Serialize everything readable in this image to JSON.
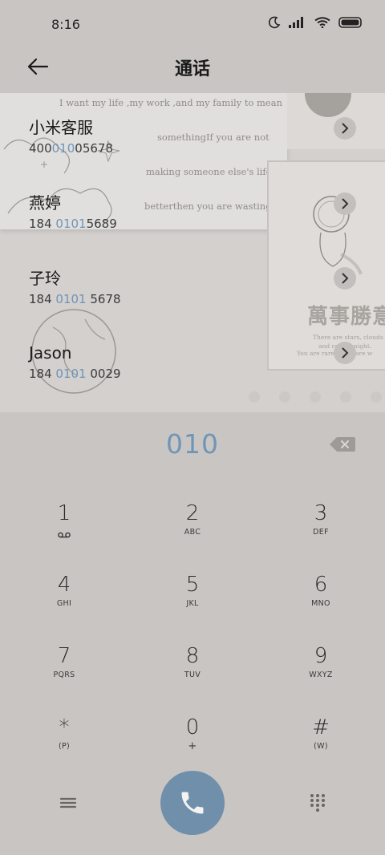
{
  "status": {
    "time": "8:16"
  },
  "header": {
    "title": "通话"
  },
  "wallpaper": {
    "quotes": [
      "I want my life ,my work ,and my family to mean",
      "somethingIf you are not",
      "making someone else's life",
      "betterthen you are wasting"
    ],
    "poster_big": "萬事勝意",
    "poster_small": [
      "There are stars, clouds",
      "and rain at night.",
      "You are rarer this rare w"
    ]
  },
  "contacts": [
    {
      "name": "小米客服",
      "num_pre": "400",
      "num_hl": "010",
      "num_post": "05678"
    },
    {
      "name": "燕婷",
      "num_pre": "184 ",
      "num_hl": "0101",
      "num_post": "5689"
    },
    {
      "name": "子玲",
      "num_pre": "184 ",
      "num_hl": "0101",
      "num_post": " 5678"
    },
    {
      "name": "Jason",
      "num_pre": "184 ",
      "num_hl": "0101",
      "num_post": " 0029"
    }
  ],
  "dialer": {
    "input": "010",
    "keys": [
      {
        "digit": "1",
        "letters": ""
      },
      {
        "digit": "2",
        "letters": "ABC"
      },
      {
        "digit": "3",
        "letters": "DEF"
      },
      {
        "digit": "4",
        "letters": "GHI"
      },
      {
        "digit": "5",
        "letters": "JKL"
      },
      {
        "digit": "6",
        "letters": "MNO"
      },
      {
        "digit": "7",
        "letters": "PQRS"
      },
      {
        "digit": "8",
        "letters": "TUV"
      },
      {
        "digit": "9",
        "letters": "WXYZ"
      },
      {
        "digit": "*",
        "letters": "(P)"
      },
      {
        "digit": "0",
        "letters": "+"
      },
      {
        "digit": "#",
        "letters": "(W)"
      }
    ]
  },
  "colors": {
    "accent": "#6f95b8",
    "call_button": "#6f8faa",
    "background": "#c9c5c3"
  }
}
